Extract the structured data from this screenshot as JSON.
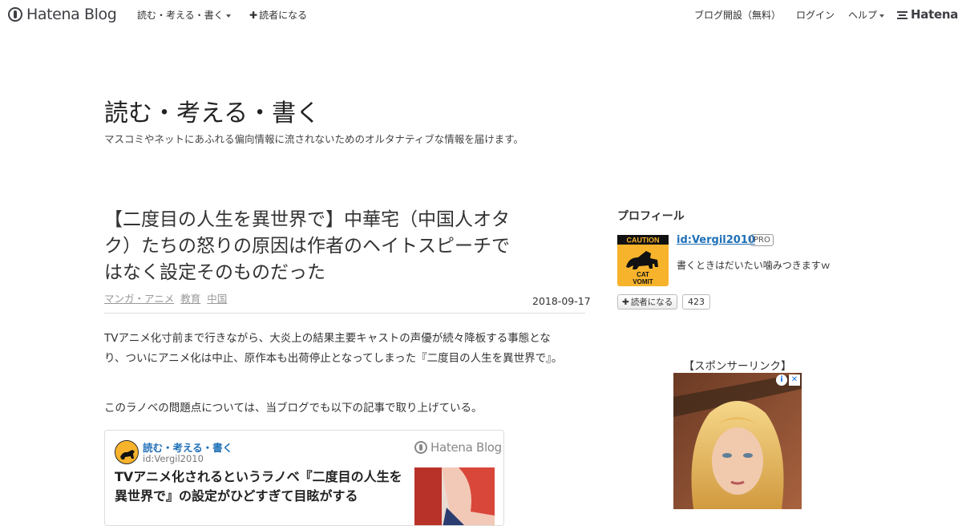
{
  "topbar": {
    "brand": "Hatena Blog",
    "blog_menu_label": "読む・考える・書く",
    "subscribe_label": "読者になる",
    "open_blog_label": "ブログ開設（無料）",
    "login_label": "ログイン",
    "help_label": "ヘルプ",
    "hatena_logo": "Hatena"
  },
  "blog": {
    "title": "読む・考える・書く",
    "description": "マスコミやネットにあふれる偏向情報に流されないためのオルタナティブな情報を届けます。"
  },
  "entry": {
    "title": "【二度目の人生を異世界で】中華宅（中国人オタク）たちの怒りの原因は作者のヘイトスピーチではなく設定そのものだった",
    "categories": [
      "マンガ・アニメ",
      "教育",
      "中国"
    ],
    "date": "2018-09-17",
    "paragraphs": [
      "TVアニメ化寸前まで行きながら、大炎上の結果主要キャストの声優が続々降板する事態となり、ついにアニメ化は中止、原作本も出荷停止となってしまった『二度目の人生を異世界で』。",
      "このラノベの問題点については、当ブログでも以下の記事で取り上げている。"
    ],
    "embed": {
      "blog_name": "読む・考える・書く",
      "user_id": "id:Vergil2010",
      "brand": "Hatena Blog",
      "title": "TVアニメ化されるというラノベ『二度目の人生を異世界で』の設定がひどすぎて目眩がする"
    }
  },
  "sidebar": {
    "profile_heading": "プロフィール",
    "profile_id": "id:Vergil2010",
    "pro_badge": "PRO",
    "profile_desc": "書くときはだいたい噛みつきますｗ",
    "profile_icon_text_top": "CAUTION",
    "profile_icon_text_bottom_1": "CAT",
    "profile_icon_text_bottom_2": "VOMIT",
    "subscribe_label": "読者になる",
    "subscriber_count": "423",
    "sponsor_heading": "【スポンサーリンク】",
    "ad_info_symbol": "i",
    "ad_close_symbol": "✕"
  },
  "colors": {
    "link": "#1e6fb7",
    "caution_yellow": "#f7b32b",
    "text": "#333333"
  }
}
